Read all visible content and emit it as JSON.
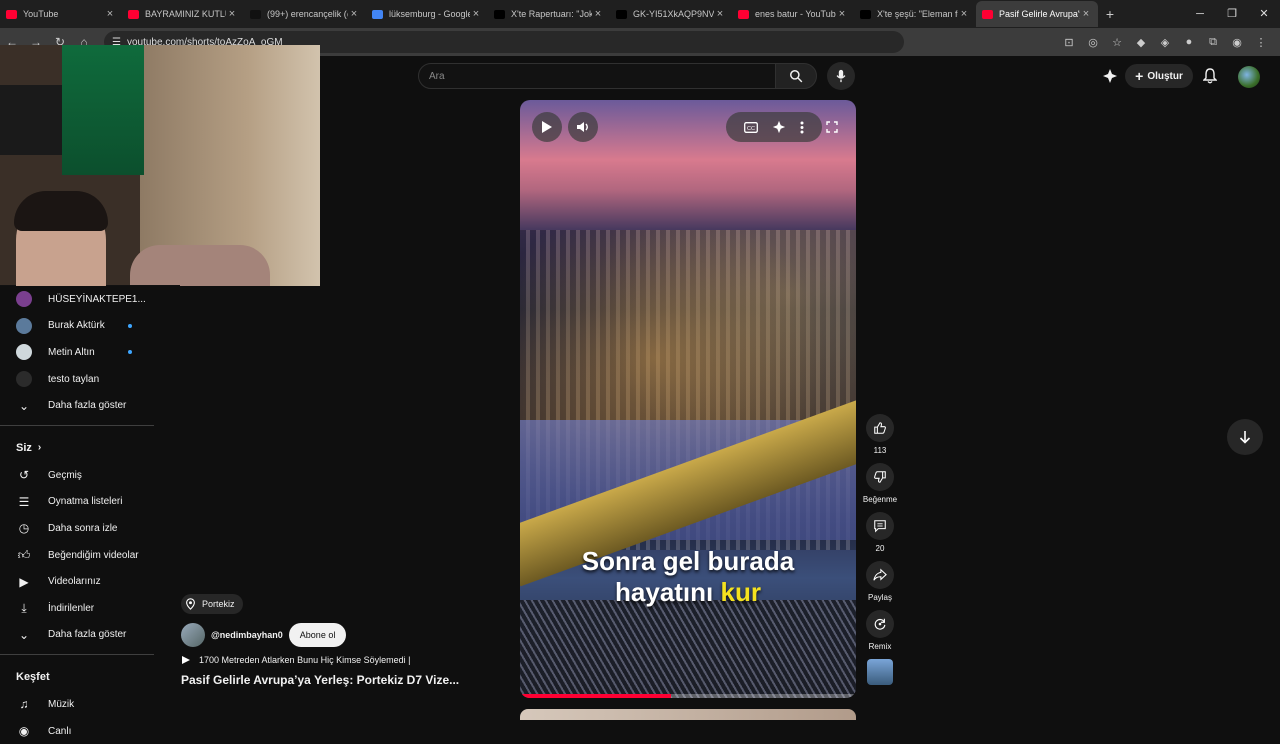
{
  "browser": {
    "tabs": [
      {
        "label": "YouTube",
        "color": "#ff0033",
        "active": false
      },
      {
        "label": "BAYRAMINIZ KUTLU",
        "color": "#ff0033",
        "active": false
      },
      {
        "label": "(99+) erencançelik (@",
        "color": "#111111",
        "active": false
      },
      {
        "label": "lüksemburg - Google",
        "color": "#4285f4",
        "active": false
      },
      {
        "label": "X'te Rapertuarı: \"Joke",
        "color": "#000000",
        "active": false
      },
      {
        "label": "GK-YI51XkAQP9NV (",
        "color": "#000000",
        "active": false
      },
      {
        "label": "enes batur - YouTube",
        "color": "#ff0033",
        "active": false
      },
      {
        "label": "X'te şeşü: \"Eleman fe",
        "color": "#000000",
        "active": false
      },
      {
        "label": "Pasif Gelirle Avrupa'y",
        "color": "#ff0033",
        "active": true
      }
    ],
    "url": "youtube.com/shorts/toAzZoA_oGM"
  },
  "header": {
    "search_placeholder": "Ara",
    "create_label": "Oluştur"
  },
  "sidebar": {
    "subscriptions": [
      {
        "name": "HÜSEYİNAKTEPE1...",
        "avatar_color": "#7a3f8e",
        "new": false
      },
      {
        "name": "Burak Aktürk",
        "avatar_color": "#5b7a9b",
        "new": true
      },
      {
        "name": "Metin Altın",
        "avatar_color": "#cfd8dc",
        "new": true
      },
      {
        "name": "testo taylan",
        "avatar_color": "#2b2b2b",
        "new": false
      }
    ],
    "show_more": "Daha fazla göster",
    "you_heading": "Siz",
    "you_items": [
      {
        "label": "Geçmiş",
        "icon": "history-icon"
      },
      {
        "label": "Oynatma listeleri",
        "icon": "playlist-icon"
      },
      {
        "label": "Daha sonra izle",
        "icon": "watch-later-icon"
      },
      {
        "label": "Beğendiğim videolar",
        "icon": "like-icon"
      },
      {
        "label": "Videolarınız",
        "icon": "your-videos-icon"
      },
      {
        "label": "İndirilenler",
        "icon": "download-icon"
      }
    ],
    "show_more_2": "Daha fazla göster",
    "explore_heading": "Keşfet",
    "explore_items": [
      {
        "label": "Müzik",
        "icon": "music-icon"
      },
      {
        "label": "Canlı",
        "icon": "live-icon"
      }
    ]
  },
  "video": {
    "caption_line1": "Sonra gel burada",
    "caption_line2_a": "hayatını",
    "caption_line2_b": "kur",
    "progress": 0.45
  },
  "actions": {
    "likes": "113",
    "dislike_label": "Beğenme",
    "comments": "20",
    "share_label": "Paylaş",
    "remix_label": "Remix"
  },
  "meta": {
    "location": "Portekiz",
    "channel": "@nedimbayhan0",
    "subscribe_label": "Abone ol",
    "description": "1700 Metreden Atlarken Bunu Hiç Kimse Söylemedi |",
    "title": "Pasif Gelirle Avrupa’ya Yerleş: Portekiz D7 Vize..."
  }
}
